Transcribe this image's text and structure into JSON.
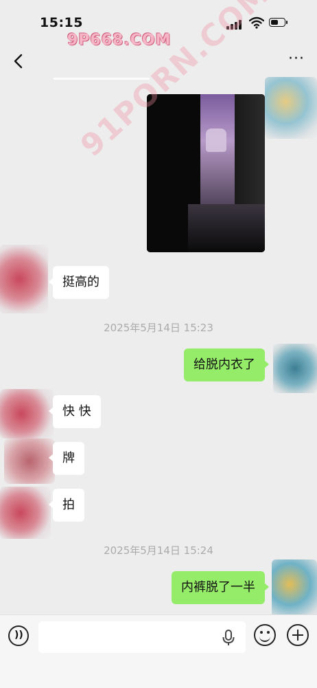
{
  "status_bar": {
    "time": "15:15",
    "watermark": "9P668.COM",
    "battery_level": 0.6
  },
  "nav": {
    "back_icon": "chevron-left-icon",
    "more_label": "···"
  },
  "image_watermark": "91PORN.COM",
  "messages": [
    {
      "side": "in",
      "text": "挺高的"
    },
    {
      "timestamp": "2025年5月14日 15:23"
    },
    {
      "side": "out",
      "text": "给脱内衣了"
    },
    {
      "side": "in",
      "text": "快 快"
    },
    {
      "side": "in",
      "text": "牌"
    },
    {
      "side": "in",
      "text": "拍"
    },
    {
      "timestamp": "2025年5月14日 15:24"
    },
    {
      "side": "out",
      "text": "内裤脱了一半"
    }
  ],
  "input_bar": {
    "value": "",
    "placeholder": ""
  },
  "colors": {
    "background": "#ededed",
    "outgoing_bubble": "#95ec69",
    "incoming_bubble": "#ffffff",
    "timestamp_text": "#aaaaaa"
  }
}
